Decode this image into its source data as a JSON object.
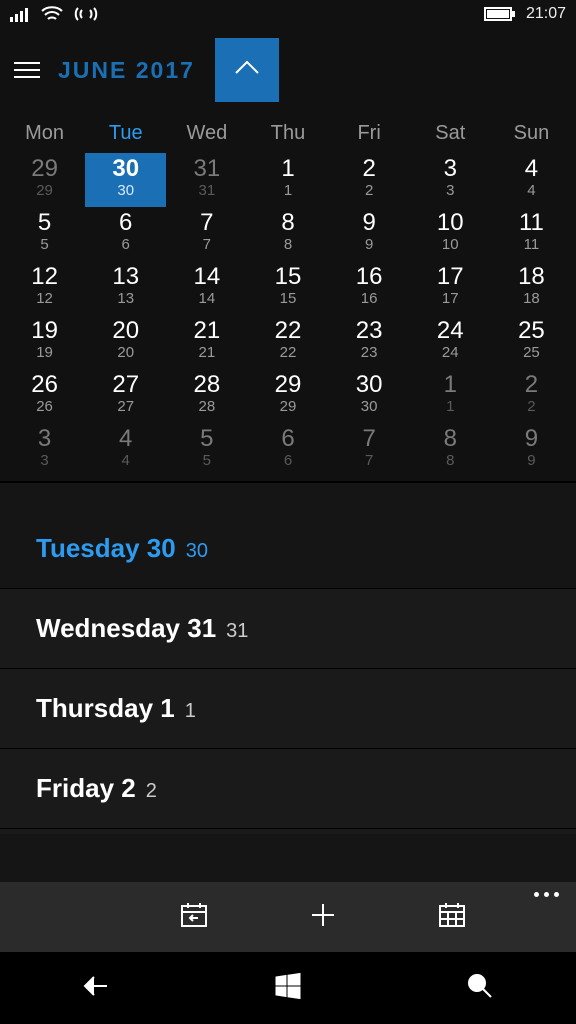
{
  "status": {
    "time": "21:07"
  },
  "header": {
    "month_label": "JUNE 2017"
  },
  "colors": {
    "accent": "#1a6fb5",
    "accent_light": "#2d9bf0"
  },
  "weekdays": [
    "Mon",
    "Tue",
    "Wed",
    "Thu",
    "Fri",
    "Sat",
    "Sun"
  ],
  "selected_weekday_index": 1,
  "calendar_rows": [
    [
      {
        "top": "29",
        "bot": "29",
        "dim": true
      },
      {
        "top": "30",
        "bot": "30",
        "dim": false,
        "selected": true
      },
      {
        "top": "31",
        "bot": "31",
        "dim": true
      },
      {
        "top": "1",
        "bot": "1",
        "dim": false
      },
      {
        "top": "2",
        "bot": "2",
        "dim": false
      },
      {
        "top": "3",
        "bot": "3",
        "dim": false
      },
      {
        "top": "4",
        "bot": "4",
        "dim": false
      }
    ],
    [
      {
        "top": "5",
        "bot": "5"
      },
      {
        "top": "6",
        "bot": "6"
      },
      {
        "top": "7",
        "bot": "7"
      },
      {
        "top": "8",
        "bot": "8"
      },
      {
        "top": "9",
        "bot": "9"
      },
      {
        "top": "10",
        "bot": "10"
      },
      {
        "top": "11",
        "bot": "11"
      }
    ],
    [
      {
        "top": "12",
        "bot": "12"
      },
      {
        "top": "13",
        "bot": "13"
      },
      {
        "top": "14",
        "bot": "14"
      },
      {
        "top": "15",
        "bot": "15"
      },
      {
        "top": "16",
        "bot": "16"
      },
      {
        "top": "17",
        "bot": "17"
      },
      {
        "top": "18",
        "bot": "18"
      }
    ],
    [
      {
        "top": "19",
        "bot": "19"
      },
      {
        "top": "20",
        "bot": "20"
      },
      {
        "top": "21",
        "bot": "21"
      },
      {
        "top": "22",
        "bot": "22"
      },
      {
        "top": "23",
        "bot": "23"
      },
      {
        "top": "24",
        "bot": "24"
      },
      {
        "top": "25",
        "bot": "25"
      }
    ],
    [
      {
        "top": "26",
        "bot": "26"
      },
      {
        "top": "27",
        "bot": "27"
      },
      {
        "top": "28",
        "bot": "28"
      },
      {
        "top": "29",
        "bot": "29"
      },
      {
        "top": "30",
        "bot": "30"
      },
      {
        "top": "1",
        "bot": "1",
        "dim": true
      },
      {
        "top": "2",
        "bot": "2",
        "dim": true
      }
    ],
    [
      {
        "top": "3",
        "bot": "3",
        "dim": true
      },
      {
        "top": "4",
        "bot": "4",
        "dim": true
      },
      {
        "top": "5",
        "bot": "5",
        "dim": true
      },
      {
        "top": "6",
        "bot": "6",
        "dim": true
      },
      {
        "top": "7",
        "bot": "7",
        "dim": true
      },
      {
        "top": "8",
        "bot": "8",
        "dim": true
      },
      {
        "top": "9",
        "bot": "9",
        "dim": true
      }
    ]
  ],
  "agenda": [
    {
      "main": "Tuesday 30",
      "sec": "30",
      "selected": true
    },
    {
      "main": "Wednesday 31",
      "sec": "31"
    },
    {
      "main": "Thursday 1",
      "sec": "1"
    },
    {
      "main": "Friday 2",
      "sec": "2"
    }
  ]
}
